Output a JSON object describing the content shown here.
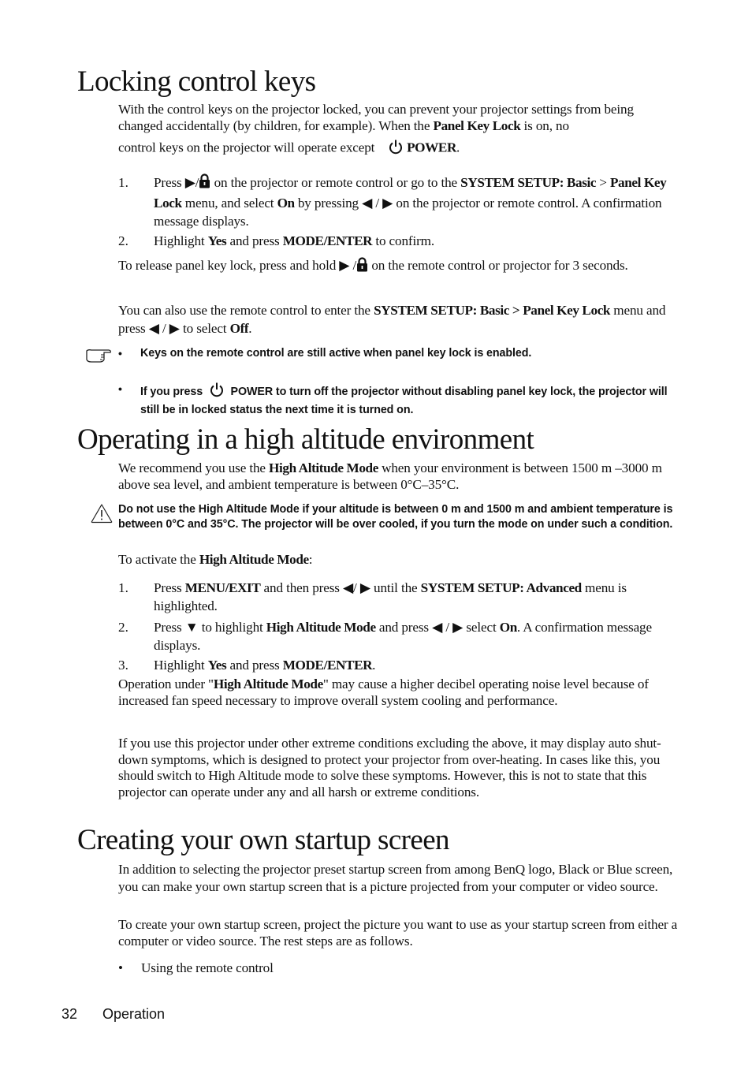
{
  "sections": [
    {
      "title": "Locking control keys",
      "intro": {
        "t1": "With the control keys on the projector locked, you can prevent your projector settings from being changed accidentally (by children, for example). When the ",
        "b1": "Panel Key Lock",
        "t2": " is on, no control keys on the projector will operate except ",
        "b2": "POWER",
        "t3": "."
      },
      "steps": [
        {
          "num": "1.",
          "t1": "Press ",
          "t2": " on the projector or remote control or go to the ",
          "b1": "SYSTEM SETUP: Basic",
          "t3": " > ",
          "b2": "Panel Key Lock",
          "t4": " menu, and select ",
          "b3": "On",
          "t5": " by pressing ",
          "t6": " on the projector or remote control. A confirmation message displays."
        },
        {
          "num": "2.",
          "t1": "Highlight ",
          "b1": "Yes",
          "t2": " and press ",
          "b2": "MODE/ENTER",
          "t3": " to confirm."
        }
      ],
      "release": {
        "t1": "To release panel key lock, press and hold ",
        "t2": " on the remote control or projector for 3 seconds."
      },
      "remote": {
        "t1": "You can also use the remote control to enter the ",
        "b1": "SYSTEM SETUP: Basic > Panel Key Lock",
        "t2": " menu and press ",
        "t3": " to select ",
        "b2": "Off",
        "t4": "."
      },
      "notes": [
        {
          "text": "Keys on the remote control are still active when panel key lock is enabled."
        },
        {
          "t1": "If you press ",
          "t2": " POWER to turn off the projector without disabling panel key lock, the projector will still be in locked status the next time it is turned on."
        }
      ]
    },
    {
      "title": "Operating in a high altitude environment",
      "intro": {
        "t1": "We recommend you use the ",
        "b1": "High Altitude Mode",
        "t2": " when your environment is between 1500 m –3000 m above sea level, and ambient temperature is between 0°C–35°C."
      },
      "warning": "Do not use the High Altitude Mode if your altitude is between 0 m and 1500 m and ambient temperature is between 0°C and 35°C. The projector will be over cooled, if you turn the mode on under such a condition.",
      "activate": {
        "t1": "To activate the ",
        "b1": "High Altitude Mode",
        "t2": ":"
      },
      "steps": [
        {
          "num": "1.",
          "t1": "Press ",
          "b1": "MENU/EXIT",
          "t2": " and then press ",
          "t3": " until the ",
          "b2": "SYSTEM SETUP: Advanced",
          "t4": " menu is highlighted."
        },
        {
          "num": "2.",
          "t1": "Press ",
          "t2": " to highlight ",
          "b1": "High Altitude Mode",
          "t3": " and press ",
          "t4": " select ",
          "b2": "On",
          "t5": ". A confirmation message displays."
        },
        {
          "num": "3.",
          "t1": "Highlight ",
          "b1": "Yes",
          "t2": " and press ",
          "b2": "MODE/ENTER",
          "t3": "."
        }
      ],
      "operation": {
        "t1": "Operation under \"",
        "b1": "High Altitude Mode",
        "t2": "\" may cause a higher decibel operating noise level because of increased fan speed necessary to improve overall system cooling and performance."
      },
      "extreme": "If you use this projector under other extreme conditions excluding the above, it may display auto shut-down symptoms, which is designed to protect your projector from over-heating. In cases like this, you should switch to High Altitude mode to solve these symptoms. However, this is not to state that this projector can operate under any and all harsh or extreme conditions."
    },
    {
      "title": "Creating your own startup screen",
      "p1": "In addition to selecting the projector preset startup screen from among BenQ logo, Black or Blue screen, you can make your own startup screen that is a picture projected from your computer or video source.",
      "p2": "To create your own startup screen, project the picture you want to use as your startup screen from either a computer or video source. The rest steps are as follows.",
      "bullets": [
        "Using the remote control"
      ]
    }
  ],
  "symbols": {
    "bullet": "•",
    "slash": "/",
    "left": "◀",
    "right": "▶",
    "down": "▼"
  },
  "footer": {
    "page_number": "32",
    "section": "Operation"
  }
}
